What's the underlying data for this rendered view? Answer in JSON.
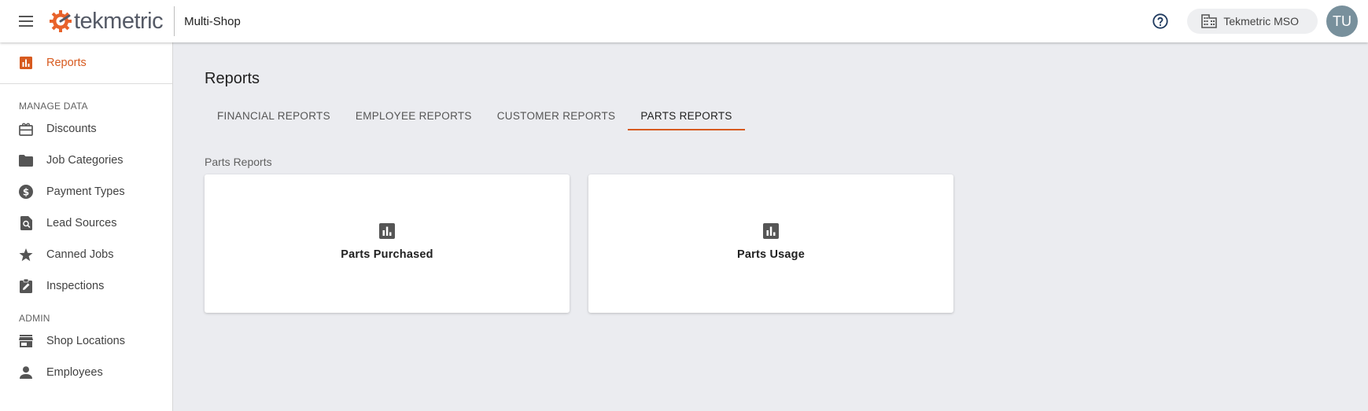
{
  "header": {
    "logo_text": "tekmetric",
    "shop_label": "Multi-Shop",
    "org_name": "Tekmetric MSO",
    "avatar_initials": "TU",
    "brand_color": "#e8622a"
  },
  "sidebar": {
    "active_item": {
      "label": "Reports",
      "icon": "bar-chart-icon"
    },
    "manage_section_label": "MANAGE DATA",
    "manage_items": [
      {
        "label": "Discounts",
        "icon": "discount-icon"
      },
      {
        "label": "Job Categories",
        "icon": "folder-icon"
      },
      {
        "label": "Payment Types",
        "icon": "dollar-circle-icon"
      },
      {
        "label": "Lead Sources",
        "icon": "search-document-icon"
      },
      {
        "label": "Canned Jobs",
        "icon": "star-icon"
      },
      {
        "label": "Inspections",
        "icon": "clipboard-edit-icon"
      }
    ],
    "admin_section_label": "ADMIN",
    "admin_items": [
      {
        "label": "Shop Locations",
        "icon": "store-icon"
      },
      {
        "label": "Employees",
        "icon": "person-icon"
      }
    ]
  },
  "main": {
    "title": "Reports",
    "tabs": [
      {
        "label": "FINANCIAL REPORTS",
        "active": false
      },
      {
        "label": "EMPLOYEE REPORTS",
        "active": false
      },
      {
        "label": "CUSTOMER REPORTS",
        "active": false
      },
      {
        "label": "PARTS REPORTS",
        "active": true
      }
    ],
    "section_title": "Parts Reports",
    "cards": [
      {
        "label": "Parts Purchased",
        "icon": "bar-chart-icon"
      },
      {
        "label": "Parts Usage",
        "icon": "bar-chart-icon"
      }
    ]
  },
  "colors": {
    "accent": "#d75a1f",
    "background": "#ebecf0",
    "avatar": "#78909c"
  }
}
